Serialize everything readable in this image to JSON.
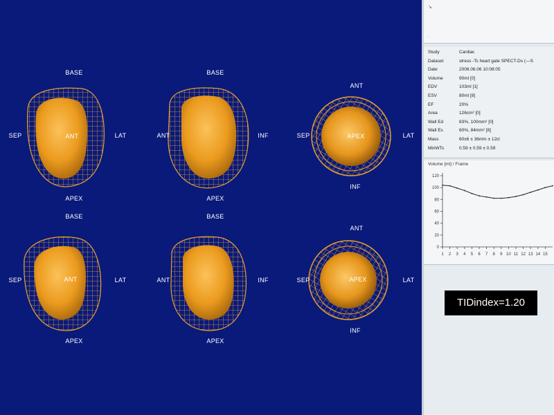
{
  "views": {
    "top_left": {
      "top": "BASE",
      "bottom": "APEX",
      "left": "SEP",
      "right": "LAT",
      "center": "ANT"
    },
    "top_mid": {
      "top": "BASE",
      "bottom": "APEX",
      "left": "ANT",
      "right": "INF"
    },
    "top_right": {
      "top": "ANT",
      "bottom": "INF",
      "left": "SEP",
      "right": "LAT",
      "center": "APEX"
    },
    "bot_left": {
      "top": "BASE",
      "bottom": "APEX",
      "left": "SEP",
      "right": "LAT",
      "center": "ANT"
    },
    "bot_mid": {
      "top": "BASE",
      "bottom": "APEX",
      "left": "ANT",
      "right": "INF"
    },
    "bot_right": {
      "top": "ANT",
      "bottom": "INF",
      "left": "SEP",
      "right": "LAT",
      "center": "APEX"
    }
  },
  "colors": {
    "background": "#0a1a7a",
    "myocardium": "#f0a020",
    "mesh": "#e8a030"
  },
  "panel": {
    "info": [
      {
        "key": "Study",
        "value": "Cardiac"
      },
      {
        "key": "Dataset",
        "value": "stress -Tc  heart gate SPECT-Ds (—S"
      },
      {
        "key": "Date",
        "value": "2008.06.06 10:08:05"
      },
      {
        "key": "Volume",
        "value": "90ml [0]"
      },
      {
        "key": "EDV",
        "value": "103ml [1]"
      },
      {
        "key": "ESV",
        "value": "80ml [8]"
      },
      {
        "key": "EF",
        "value": "20%"
      },
      {
        "key": "Area",
        "value": "126cm² [0]"
      },
      {
        "key": "Wall Ed",
        "value": "83%, 100mm² [0]"
      },
      {
        "key": "Wall Es",
        "value": "60%, 84mm² [8]"
      },
      {
        "key": "Mass",
        "value": "60±6 ± 36mm ± 12cl"
      },
      {
        "key": "MinWTs",
        "value": "0.59 ± 0.59 ± 0.59"
      }
    ],
    "tid_index": "TIDindex=1.20"
  },
  "chart_data": {
    "type": "line",
    "title": "Volume [ml] / Frame",
    "x": [
      1,
      2,
      3,
      4,
      5,
      6,
      7,
      8,
      9,
      10,
      11,
      12,
      13,
      14,
      15,
      16
    ],
    "series": [
      {
        "values": [
          104,
          103,
          99,
          95,
          90,
          86,
          84,
          82,
          82,
          83,
          85,
          88,
          92,
          96,
          100,
          103
        ]
      }
    ],
    "ylim": [
      0,
      120
    ],
    "yticks": [
      "0",
      "20",
      "40",
      "60",
      "80",
      "100",
      "120"
    ],
    "xticks": [
      "1",
      "2",
      "3",
      "4",
      "5",
      "6",
      "7",
      "8",
      "9",
      "10",
      "11",
      "12",
      "13",
      "14",
      "15"
    ]
  }
}
